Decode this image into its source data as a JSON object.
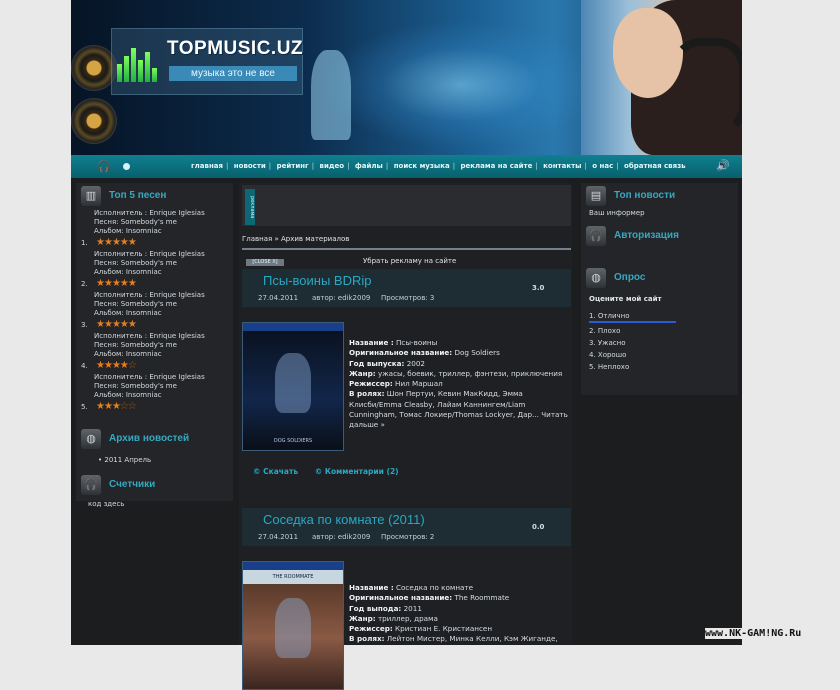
{
  "header": {
    "logo_text": "TOPMUSIC.UZ",
    "slogan": "музыка это не все"
  },
  "nav": {
    "links": [
      "главная",
      "новости",
      "рейтинг",
      "видео",
      "файлы",
      "поиск музыка",
      "реклама на сайте",
      "контакты",
      "о нас",
      "обратная связь"
    ]
  },
  "left": {
    "top5": {
      "title": "Топ 5 песен",
      "songs": [
        {
          "num": "1.",
          "artist": "Исполнитель : Enrique Iglesias",
          "song": "Песня: Somebody's me",
          "album": "Альбом: Insomniac",
          "rating": 5
        },
        {
          "num": "2.",
          "artist": "Исполнитель : Enrique Iglesias",
          "song": "Песня: Somebody's me",
          "album": "Альбом: Insomniac",
          "rating": 5
        },
        {
          "num": "3.",
          "artist": "Исполнитель : Enrique Iglesias",
          "song": "Песня: Somebody's me",
          "album": "Альбом: Insomniac",
          "rating": 5
        },
        {
          "num": "4.",
          "artist": "Исполнитель : Enrique Iglesias",
          "song": "Песня: Somebody's me",
          "album": "Альбом: Insomniac",
          "rating": 4
        },
        {
          "num": "5.",
          "artist": "Исполнитель : Enrique Iglesias",
          "song": "Песня: Somebody's me",
          "album": "Альбом: Insomniac",
          "rating": 3
        }
      ]
    },
    "archive": {
      "title": "Архив новостей",
      "item": "2011 Апрель"
    },
    "counters": {
      "title": "Счетчики",
      "text": "код здесь"
    }
  },
  "center": {
    "ad_tab": "реклама",
    "breadcrumb": "Главная » Архив материалов",
    "close_label": "[CLOSE X]",
    "remove_ad": "Убрать рекламу на сайте",
    "posts": [
      {
        "title": "Псы-воины BDRip",
        "date": "27.04.2011",
        "author": "автор: edik2009",
        "views": "Просмотров: 3",
        "rating": "3.0",
        "poster_caption": "DOG SOLDIERS",
        "fields": [
          {
            "k": "Название :",
            "v": "Псы-воины"
          },
          {
            "k": "Оригинальное название:",
            "v": "Dog Soldiers"
          },
          {
            "k": "Год выпуска:",
            "v": "2002"
          },
          {
            "k": "Жанр:",
            "v": "ужасы, боевик, триллер, фэнтези, приключения"
          },
          {
            "k": "Режиссер:",
            "v": "Нил Маршал"
          },
          {
            "k": "В ролях:",
            "v": "Шон Пертуи, Кевин МакКидд, Эмма Клисби/Emma Cleasby, Лайам Каннингем/Liam Cunningham, Томас Локиер/Thomas Lockyer, Дар... Читать дальше »"
          }
        ],
        "download": "© Скачать",
        "comments": "© Комментарии (2)"
      },
      {
        "title": "Соседка по комнате (2011)",
        "date": "27.04.2011",
        "author": "автор: edik2009",
        "views": "Просмотров: 2",
        "rating": "0.0",
        "poster_caption": "THE ROOMMATE",
        "fields": [
          {
            "k": "Название :",
            "v": "Соседка по комнате"
          },
          {
            "k": "Оригинальное название:",
            "v": "The Roommate"
          },
          {
            "k": "Год выпода:",
            "v": "2011"
          },
          {
            "k": "Жанр:",
            "v": "триллер, драма"
          },
          {
            "k": "Режиссер:",
            "v": "Кристиан Е. Кристиансен"
          },
          {
            "k": "В ролях:",
            "v": "Лейтон Мистер, Минка Келли, Кэм Жиганде,"
          }
        ]
      }
    ]
  },
  "right": {
    "news": {
      "title": "Топ новости",
      "text": "Ваш информер"
    },
    "auth": {
      "title": "Авторизация"
    },
    "poll": {
      "title": "Опрос",
      "question": "Оцените мой сайт",
      "options": [
        "1. Отлично",
        "2. Плохо",
        "3. Ужасно",
        "4. Хорошо",
        "5. Неплохо"
      ]
    }
  },
  "watermark": "www.NK-GAM!NG.Ru",
  "colors": {
    "accent": "#2aa8c2",
    "nav": "#0f7f8f",
    "stars": "#e77d1c"
  }
}
